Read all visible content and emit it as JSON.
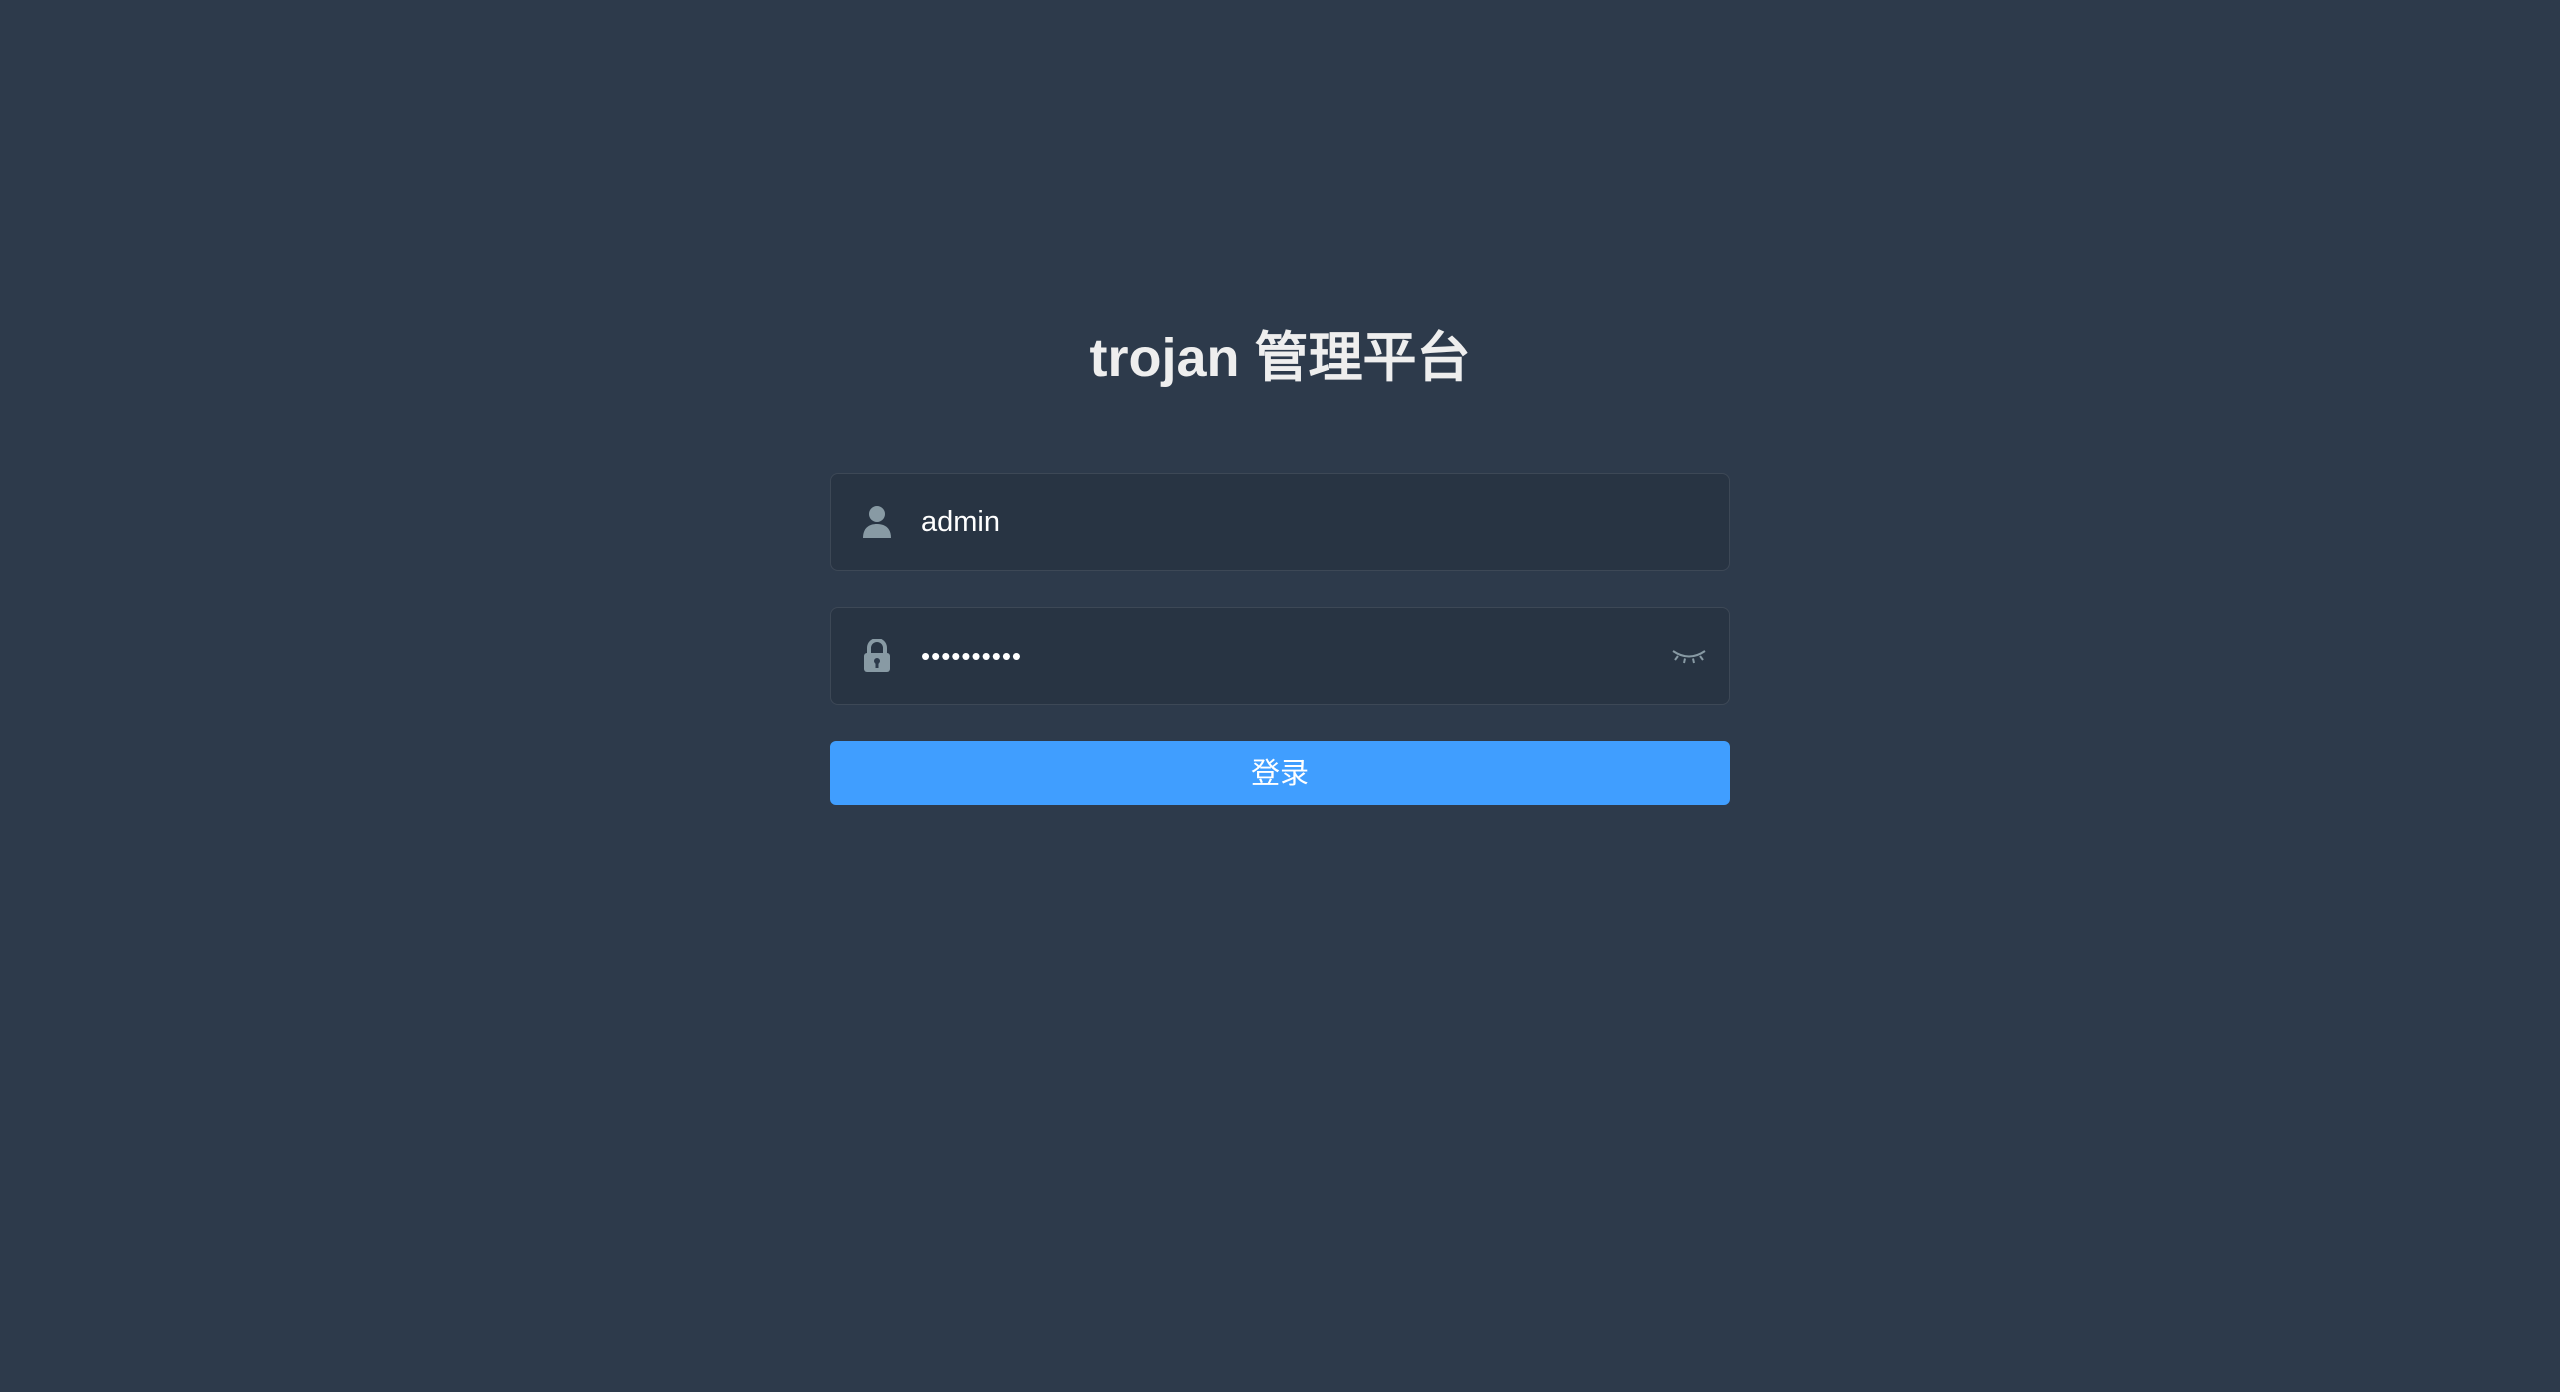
{
  "title": "trojan 管理平台",
  "form": {
    "username": {
      "value": "admin",
      "placeholder": "",
      "icon": "user-icon"
    },
    "password": {
      "value": "••••••••••",
      "placeholder": "",
      "icon": "lock-icon",
      "toggle_icon": "eye-closed-icon"
    },
    "submit_label": "登录"
  },
  "colors": {
    "background": "#2d3a4b",
    "input_background": "#283443",
    "button": "#409eff",
    "title": "#eeeeee",
    "icon": "#889aa4"
  }
}
